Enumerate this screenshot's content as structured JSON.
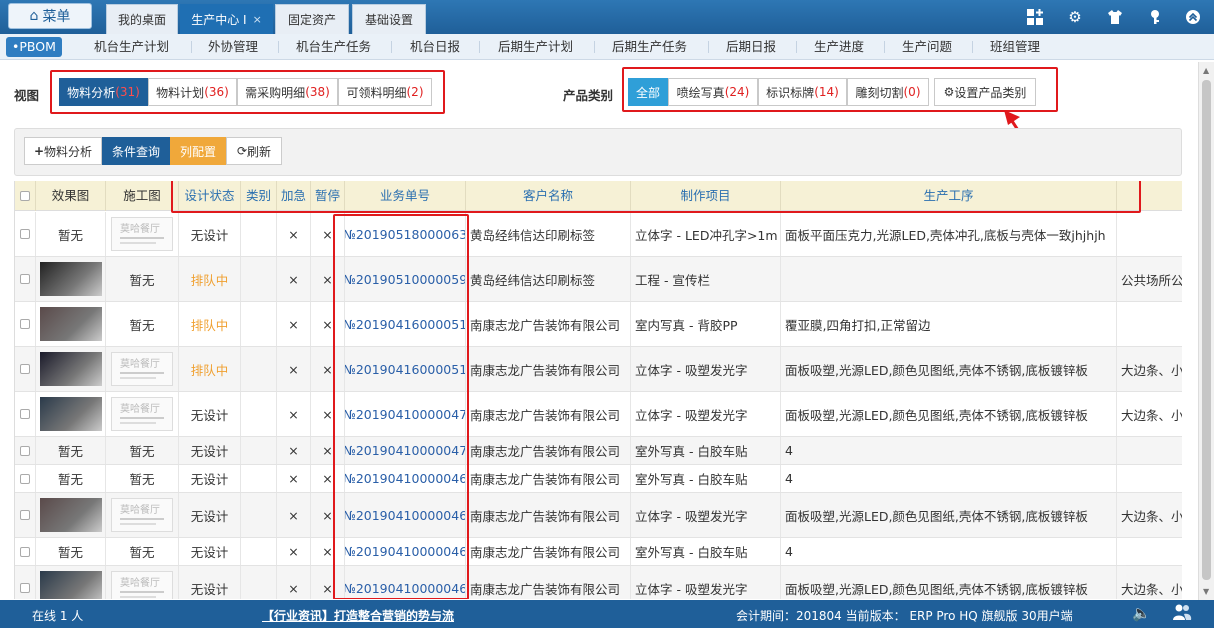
{
  "topbar": {
    "menu_label": "菜单",
    "tabs": [
      {
        "label": "我的桌面"
      },
      {
        "label": "生产中心 I",
        "close": "×"
      },
      {
        "label": "固定资产"
      },
      {
        "label": "基础设置"
      }
    ]
  },
  "subnav": {
    "items": [
      "•PBOM",
      "机台生产计划",
      "外协管理",
      "机台生产任务",
      "机台日报",
      "后期生产计划",
      "后期生产任务",
      "后期日报",
      "生产进度",
      "生产问题",
      "班组管理"
    ]
  },
  "view": {
    "label": "视图",
    "tabs": [
      {
        "name": "物料分析",
        "count": "(31)"
      },
      {
        "name": "物料计划",
        "count": "(36)"
      },
      {
        "name": "需采购明细",
        "count": "(38)"
      },
      {
        "name": "可领料明细",
        "count": "(2)"
      }
    ]
  },
  "category": {
    "label": "产品类别",
    "tabs": [
      {
        "name": "全部",
        "count": ""
      },
      {
        "name": "喷绘写真",
        "count": "(24)"
      },
      {
        "name": "标识标牌",
        "count": "(14)"
      },
      {
        "name": "雕刻切割",
        "count": "(0)"
      }
    ],
    "settings_label": "设置产品类别"
  },
  "toolbar": {
    "analysis": "物料分析",
    "query": "条件查询",
    "columns": "列配置",
    "refresh": "刷新"
  },
  "table": {
    "headers": [
      "效果图",
      "施工图",
      "设计状态",
      "类别",
      "加急",
      "暂停",
      "业务单号",
      "客户名称",
      "制作项目",
      "生产工序"
    ],
    "no_image": "暂无",
    "rows": [
      {
        "effect": "暂无",
        "drawing": "img",
        "status": "无设计",
        "urgent": "×",
        "pause": "×",
        "order": "№20190518000063",
        "customer": "黄岛经纬信达印刷标签",
        "item": "立体字 - LED冲孔字>1m",
        "process": "面板平面压克力,光源LED,壳体冲孔,底板与壳体一致jhjhjh",
        "extra": ""
      },
      {
        "effect": "img",
        "drawing": "暂无",
        "status": "排队中",
        "urgent": "×",
        "pause": "×",
        "order": "№20190510000059",
        "customer": "黄岛经纬信达印刷标签",
        "item": "工程 - 宣传栏",
        "process": "",
        "extra": "公共场所公"
      },
      {
        "effect": "img",
        "drawing": "暂无",
        "status": "排队中",
        "urgent": "×",
        "pause": "×",
        "order": "№20190416000051",
        "customer": "南康志龙广告装饰有限公司",
        "item": "室内写真 - 背胶PP",
        "process": "覆亚膜,四角打扣,正常留边",
        "extra": ""
      },
      {
        "effect": "img",
        "drawing": "img",
        "status": "排队中",
        "urgent": "×",
        "pause": "×",
        "order": "№20190416000051",
        "customer": "南康志龙广告装饰有限公司",
        "item": "立体字 - 吸塑发光字",
        "process": "面板吸塑,光源LED,颜色见图纸,壳体不锈钢,底板镀锌板",
        "extra": "大边条、小"
      },
      {
        "effect": "img",
        "drawing": "img",
        "status": "无设计",
        "urgent": "×",
        "pause": "×",
        "order": "№20190410000047",
        "customer": "南康志龙广告装饰有限公司",
        "item": "立体字 - 吸塑发光字",
        "process": "面板吸塑,光源LED,颜色见图纸,壳体不锈钢,底板镀锌板",
        "extra": "大边条、小"
      },
      {
        "effect": "暂无",
        "drawing": "暂无",
        "status": "无设计",
        "urgent": "×",
        "pause": "×",
        "order": "№20190410000047",
        "customer": "南康志龙广告装饰有限公司",
        "item": "室外写真 - 白胶车贴",
        "process": "4",
        "extra": ""
      },
      {
        "effect": "暂无",
        "drawing": "暂无",
        "status": "无设计",
        "urgent": "×",
        "pause": "×",
        "order": "№20190410000046",
        "customer": "南康志龙广告装饰有限公司",
        "item": "室外写真 - 白胶车贴",
        "process": "4",
        "extra": ""
      },
      {
        "effect": "img",
        "drawing": "img",
        "status": "无设计",
        "urgent": "×",
        "pause": "×",
        "order": "№20190410000046",
        "customer": "南康志龙广告装饰有限公司",
        "item": "立体字 - 吸塑发光字",
        "process": "面板吸塑,光源LED,颜色见图纸,壳体不锈钢,底板镀锌板",
        "extra": "大边条、小"
      },
      {
        "effect": "暂无",
        "drawing": "暂无",
        "status": "无设计",
        "urgent": "×",
        "pause": "×",
        "order": "№20190410000046",
        "customer": "南康志龙广告装饰有限公司",
        "item": "室外写真 - 白胶车贴",
        "process": "4",
        "extra": ""
      },
      {
        "effect": "img",
        "drawing": "img",
        "status": "无设计",
        "urgent": "×",
        "pause": "×",
        "order": "№20190410000046",
        "customer": "南康志龙广告装饰有限公司",
        "item": "立体字 - 吸塑发光字",
        "process": "面板吸塑,光源LED,颜色见图纸,壳体不锈钢,底板镀锌板",
        "extra": "大边条、小"
      }
    ]
  },
  "footer": {
    "online": "在线  1  人",
    "news": "【行业资讯】打造整合营销的势与流",
    "version": "会计期间：201804 当前版本： ERP Pro HQ 旗舰版 30用户端"
  },
  "colors": {
    "primary": "#1f5f99",
    "highlight": "#e0191c",
    "queued": "#f0a030"
  }
}
